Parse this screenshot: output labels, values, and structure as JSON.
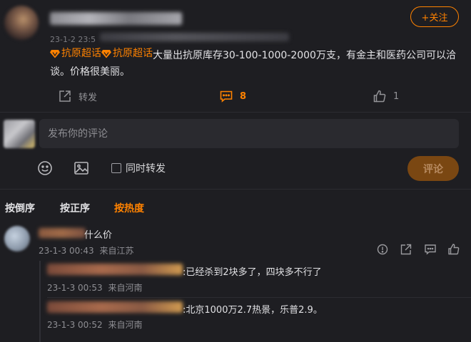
{
  "post": {
    "follow_label": "+关注",
    "date_prefix": "23-1-2 23:5",
    "topic_1": "抗原超话",
    "topic_2": "抗原超话",
    "body_text": "大量出抗原库存30-100-1000-2000万支，有金主和医药公司可以洽谈。价格很美丽。",
    "actions": {
      "repost_label": "转发",
      "comment_count": "8",
      "like_count": "1"
    }
  },
  "composer": {
    "placeholder": "发布你的评论",
    "repost_label": "同时转发",
    "submit_label": "评论"
  },
  "sort_tabs": [
    "按倒序",
    "按正序",
    "按热度"
  ],
  "comments": [
    {
      "text_tail": "什么价",
      "date": "23-1-3 00:43",
      "location": "来自江苏",
      "replies": [
        {
          "text": ":已经杀到2块多了，四块多不行了",
          "date": "23-1-3 00:53",
          "location": "来自河南"
        },
        {
          "text": ":北京1000万2.7热景，乐普2.9。",
          "date": "23-1-3 00:52",
          "location": "来自河南"
        }
      ]
    }
  ],
  "colors": {
    "accent": "#ff8200",
    "background": "#1e1e22",
    "panel": "#2a2a2f"
  },
  "icons": {
    "topic": "diamond-icon",
    "repost": "share-icon",
    "comment": "comment-icon",
    "like": "thumbs-up-icon",
    "emoji": "smiley-icon",
    "image": "image-icon",
    "report": "alert-icon"
  }
}
